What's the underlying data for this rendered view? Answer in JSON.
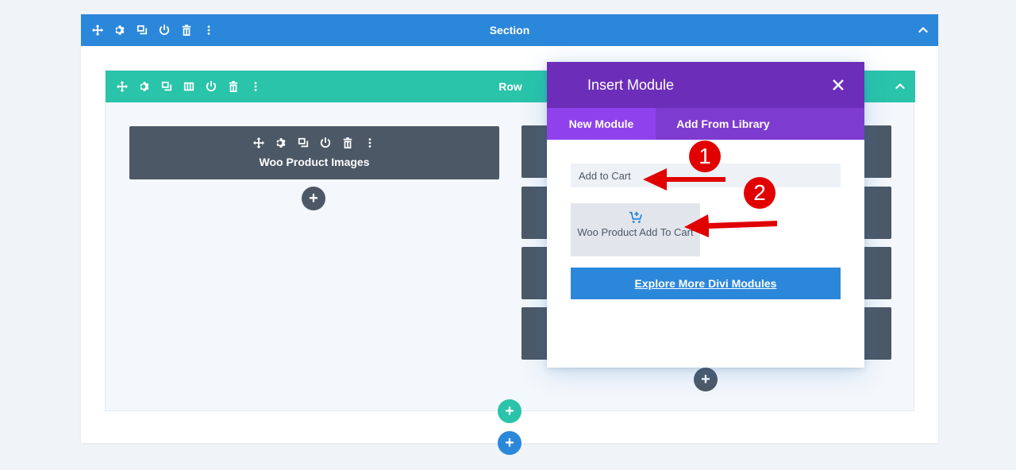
{
  "section": {
    "title": "Section"
  },
  "row": {
    "title": "Row"
  },
  "modules": [
    {
      "title": "Woo Product Images"
    }
  ],
  "modal": {
    "title": "Insert Module",
    "tabs": [
      "New Module",
      "Add From Library"
    ],
    "search_value": "Add to Cart",
    "result_label": "Woo Product Add To Cart",
    "explore_label": "Explore More Divi Modules"
  },
  "annotations": {
    "step1": "1",
    "step2": "2"
  },
  "colors": {
    "section_bar": "#2b87da",
    "row_bar": "#29c4a9",
    "modal_header": "#6c2eb9",
    "modal_tabs": "#7e3bd0",
    "module": "#4c5866",
    "annotation": "#e00000"
  },
  "icons": [
    "move-icon",
    "gear-icon",
    "duplicate-icon",
    "columns-icon",
    "power-icon",
    "trash-icon",
    "more-icon",
    "chevron-up-icon",
    "close-icon",
    "cart-icon",
    "plus-icon"
  ]
}
